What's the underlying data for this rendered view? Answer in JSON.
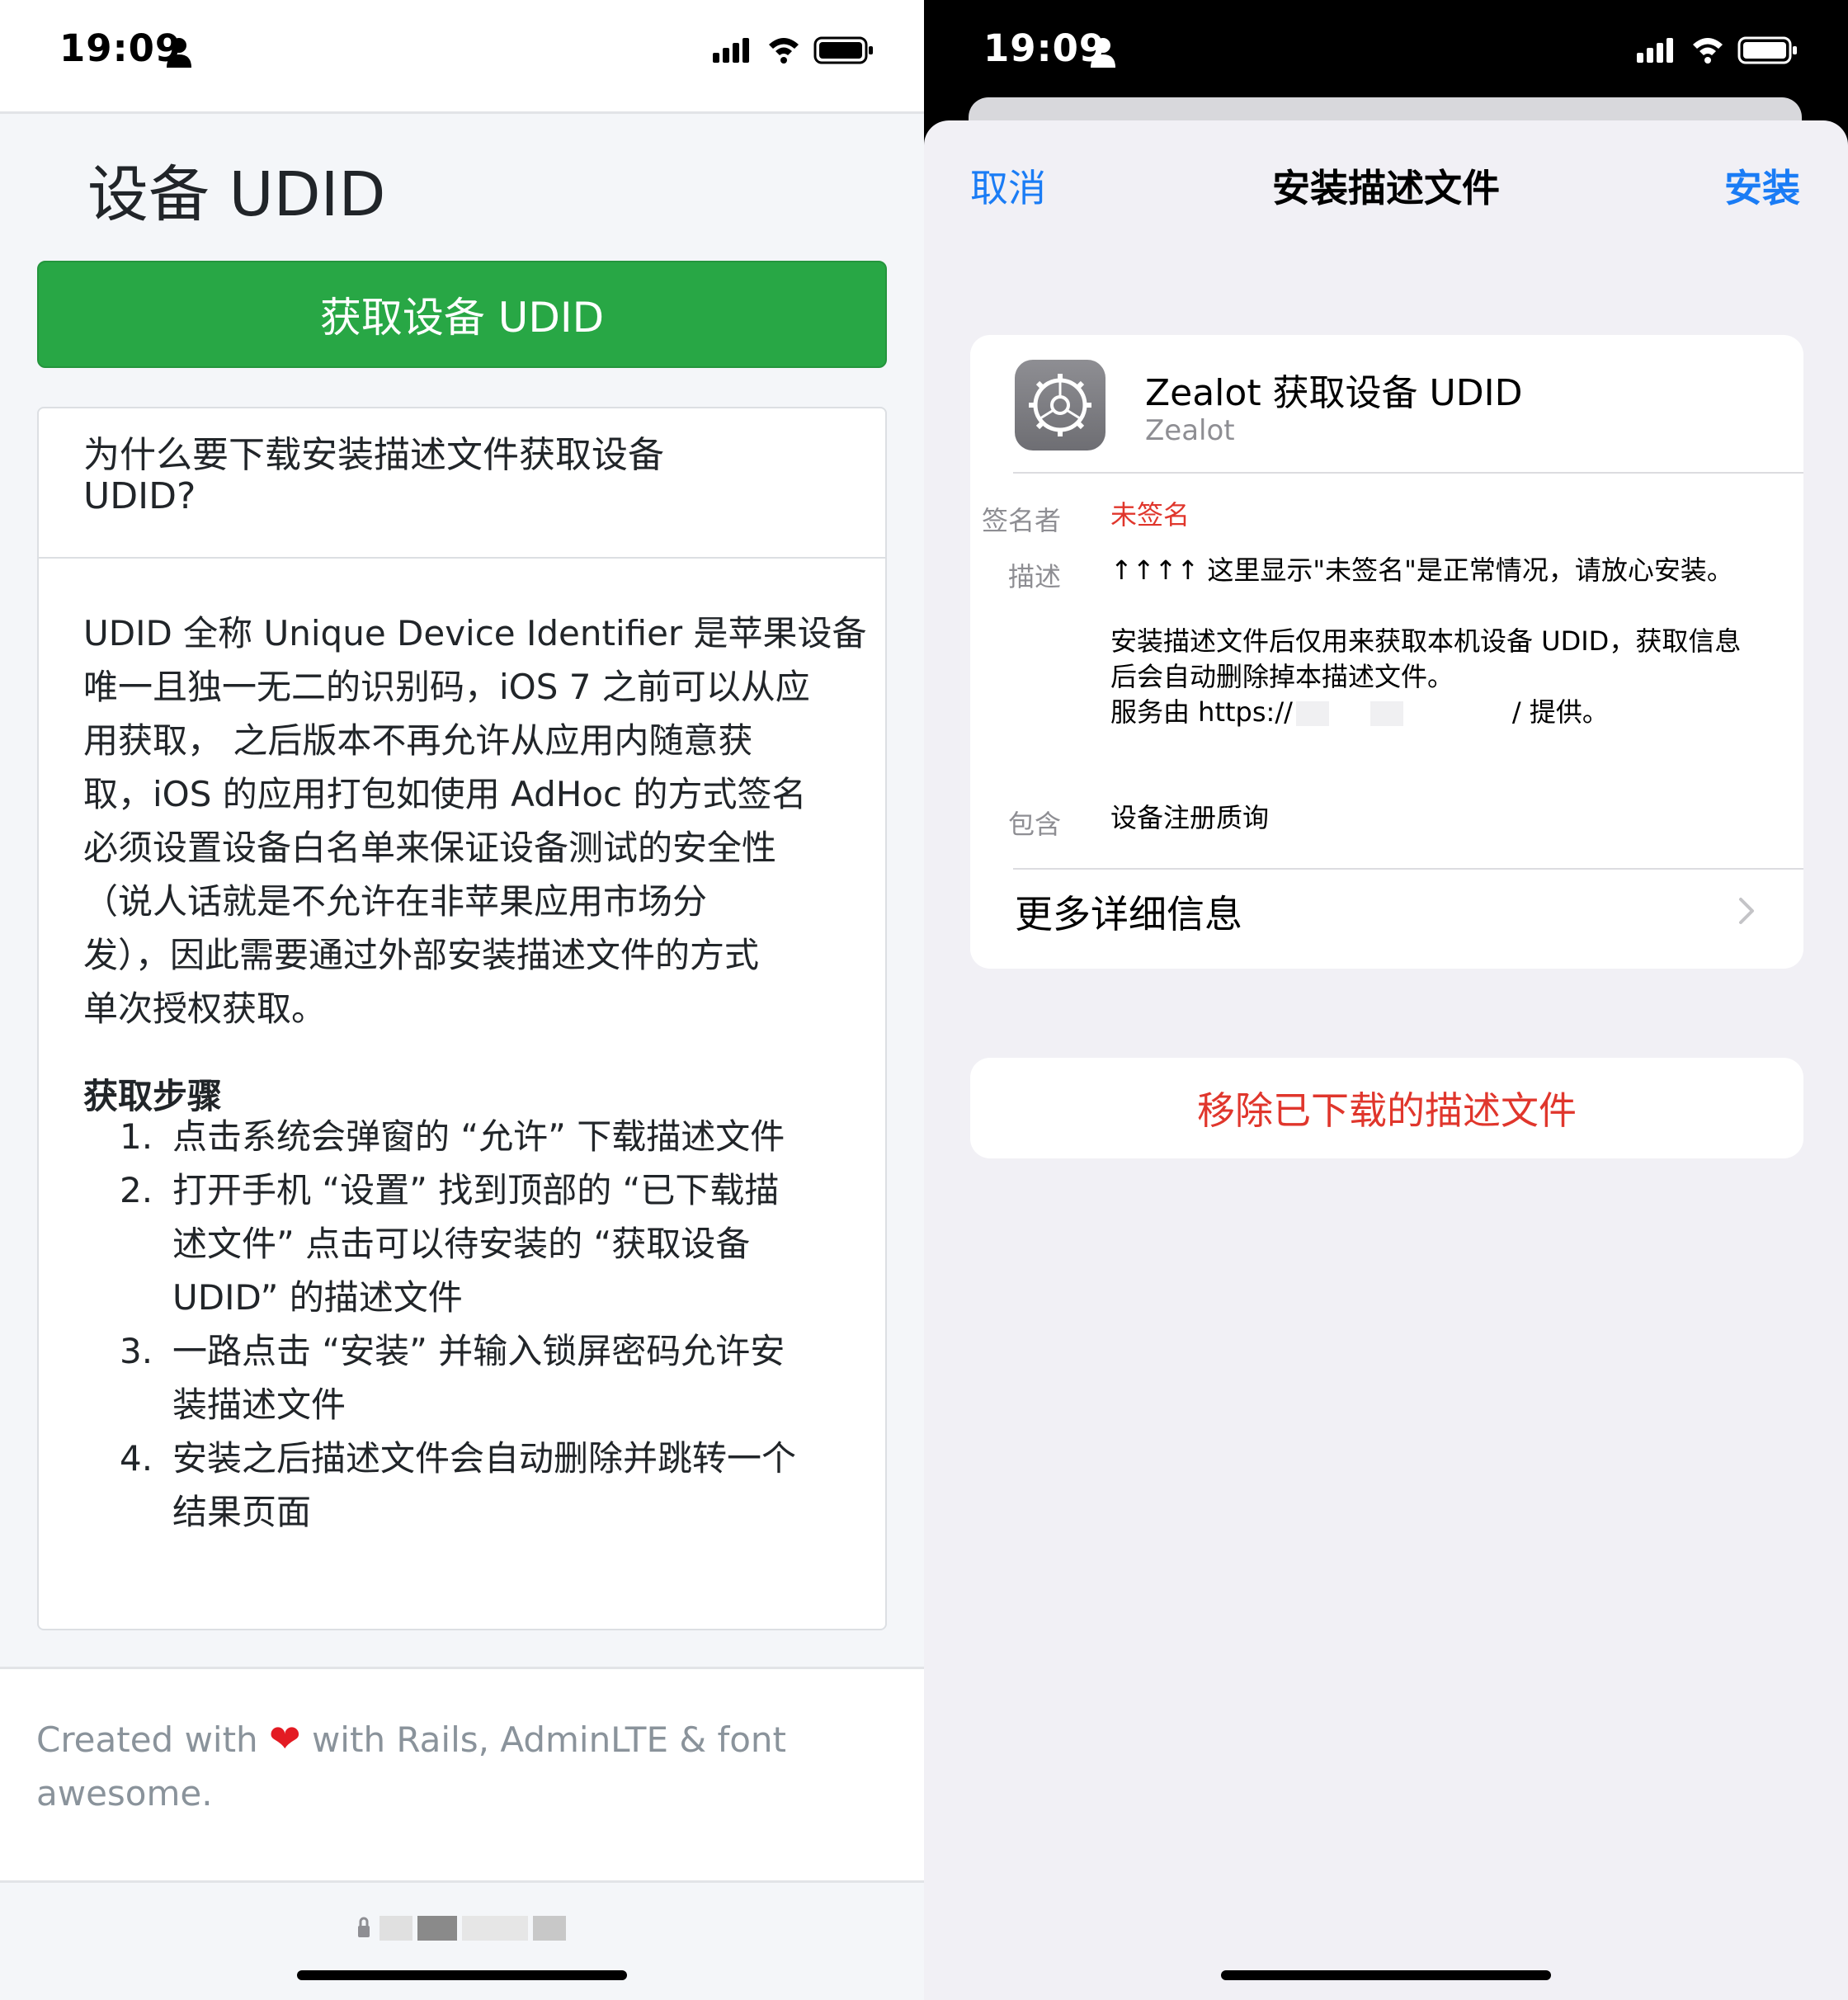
{
  "status_bar": {
    "time": "19:09"
  },
  "left": {
    "page_title": "设备 UDID",
    "get_udid_button": "获取设备 UDID",
    "card": {
      "header_line1": "为什么要下载安装描述文件获取设备",
      "header_line2": "UDID?",
      "body_lines": [
        "UDID 全称 Unique Device Identifier 是苹果设备",
        "唯一且独一无二的识别码，iOS 7 之前可以从应",
        "用获取， 之后版本不再允许从应用内随意获",
        "取，iOS 的应用打包如使用 AdHoc 的方式签名",
        "必须设置设备白名单来保证设备测试的安全性",
        "（说人话就是不允许在非苹果应用市场分",
        "发），因此需要通过外部安装描述文件的方式",
        "单次授权获取。"
      ],
      "steps_title": "获取步骤",
      "steps": [
        {
          "num": "1.",
          "lines": [
            "点击系统会弹窗的 “允许” 下载描述文件"
          ]
        },
        {
          "num": "2.",
          "lines": [
            "打开手机 “设置” 找到顶部的 “已下载描",
            "述文件” 点击可以待安装的 “获取设备",
            "UDID” 的描述文件"
          ]
        },
        {
          "num": "3.",
          "lines": [
            "一路点击 “安装” 并输入锁屏密码允许安",
            "装描述文件"
          ]
        },
        {
          "num": "4.",
          "lines": [
            "安装之后描述文件会自动删除并跳转一个",
            "结果页面"
          ]
        }
      ]
    },
    "footer": {
      "created_with": "Created with",
      "heart": "❤",
      "rest_line1": "with Rails, AdminLTE & font",
      "rest_line2": "awesome."
    }
  },
  "right": {
    "nav": {
      "cancel": "取消",
      "title": "安装描述文件",
      "install": "安装"
    },
    "profile": {
      "name": "Zealot 获取设备 UDID",
      "org": "Zealot",
      "signer_label": "签名者",
      "signer_value": "未签名",
      "description_label": "描述",
      "description_line1": "↑↑↑↑ 这里显示\"未签名\"是正常情况，请放心安装。",
      "description_line2": "安装描述文件后仅用来获取本机设备 UDID，获取信息",
      "description_line3": "后会自动删除掉本描述文件。",
      "description_line4_prefix": "服务由 https://",
      "description_line4_suffix": "/ 提供。",
      "contains_label": "包含",
      "contains_value": "设备注册质询",
      "more_details": "更多详细信息"
    },
    "remove_button": "移除已下载的描述文件"
  }
}
